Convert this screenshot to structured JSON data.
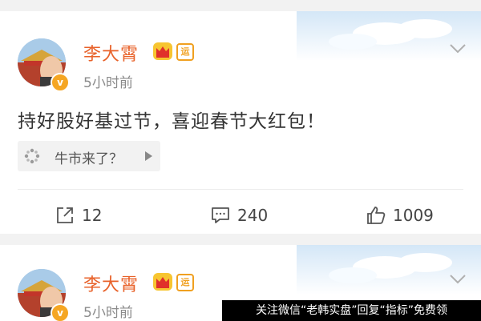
{
  "posts": [
    {
      "author": "李大霄",
      "rank_badge": "运",
      "time": "5小时前",
      "content": "持好股好基过节，喜迎春节大红包！",
      "topic": "牛市来了？",
      "actions": {
        "share_count": "12",
        "comment_count": "240",
        "like_count": "1009"
      }
    },
    {
      "author": "李大霄",
      "rank_badge": "运",
      "time": "5小时前"
    }
  ],
  "verified_badge": "v",
  "watermark": "关注微信“老韩实盘”回复“指标”免费领",
  "colors": {
    "name": "#e8622a",
    "badge": "#f5a623",
    "text": "#333333",
    "muted": "#8a8a8a",
    "background": "#f2f2f2"
  },
  "icons": [
    "crown-icon",
    "chevron-down-icon",
    "topic-icon",
    "share-icon",
    "comment-icon",
    "like-icon"
  ]
}
